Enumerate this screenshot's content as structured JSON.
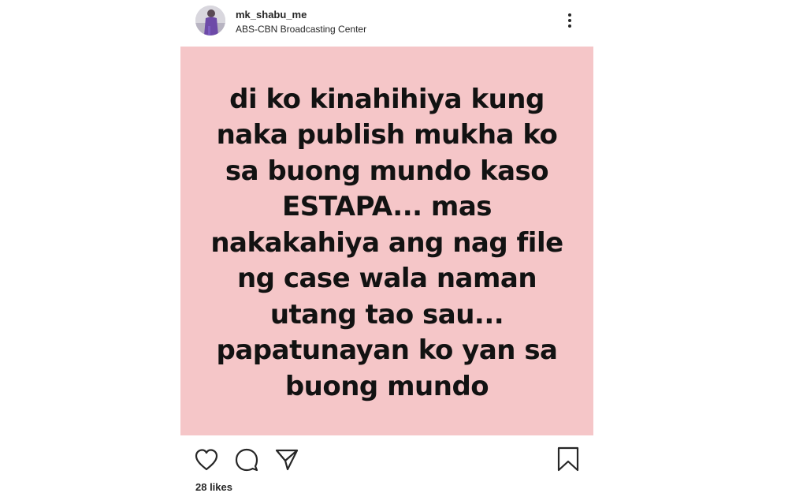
{
  "post": {
    "username": "mk_shabu_me",
    "location": "ABS-CBN Broadcasting Center",
    "image_text": "di ko kinahihiya kung naka publish mukha ko sa buong mundo kaso ESTAPA... mas nakakahiya ang  nag file ng case wala naman utang tao sau... papatunayan ko yan sa buong mundo",
    "image_background": "#f5c6c8",
    "likes": "28 likes"
  },
  "icons": {
    "avatar": "avatar",
    "more": "more-vertical-icon",
    "like": "heart-icon",
    "comment": "comment-icon",
    "share": "send-icon",
    "save": "bookmark-icon"
  }
}
